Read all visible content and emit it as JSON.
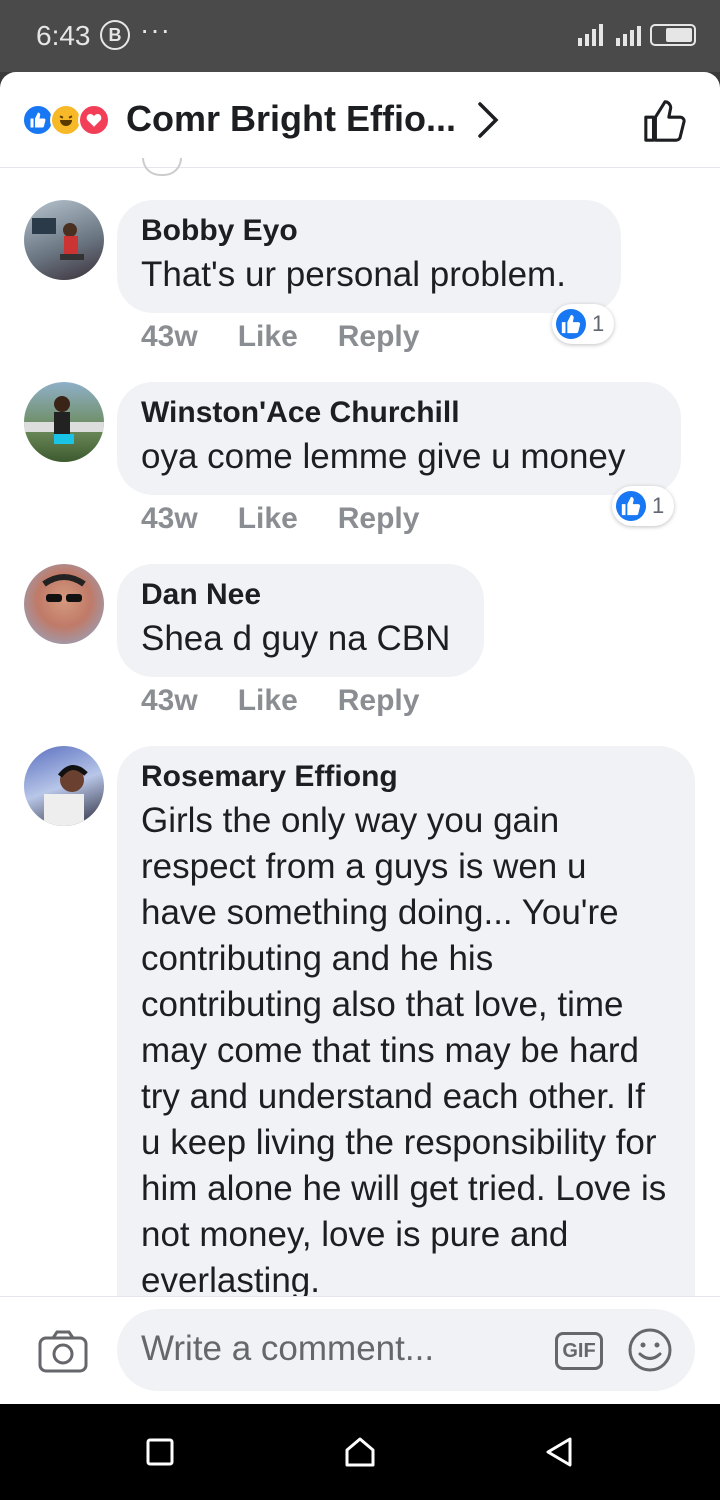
{
  "status_bar": {
    "time": "6:43",
    "badge": "B",
    "more": "···"
  },
  "header": {
    "title": "Comr Bright Effio...",
    "reactions": [
      "like-reaction-icon",
      "haha-reaction-icon",
      "love-reaction-icon"
    ]
  },
  "comments": [
    {
      "author": "Bobby Eyo",
      "text": "That's ur personal problem.",
      "time": "43w",
      "like": "Like",
      "reply": "Reply",
      "reaction_count": "1"
    },
    {
      "author": "Winston'Ace Churchill",
      "text": "oya come lemme give u money",
      "time": "43w",
      "like": "Like",
      "reply": "Reply",
      "reaction_count": "1"
    },
    {
      "author": "Dan Nee",
      "text": "Shea d guy na CBN",
      "time": "43w",
      "like": "Like",
      "reply": "Reply"
    },
    {
      "author": "Rosemary Effiong",
      "text": "Girls the only way you gain respect from a guys is wen u have something doing... You're contributing and he his contributing also that love, time may come that tins  may be hard try and understand each other. If u keep living the responsibility for him alone he will get tried. Love is not money, love is pure and everlasting."
    }
  ],
  "composer": {
    "placeholder": "Write a comment...",
    "gif_label": "GIF"
  },
  "colors": {
    "accent": "#1877f2",
    "bubble": "#f0f2f5",
    "meta": "#8a8d91"
  }
}
